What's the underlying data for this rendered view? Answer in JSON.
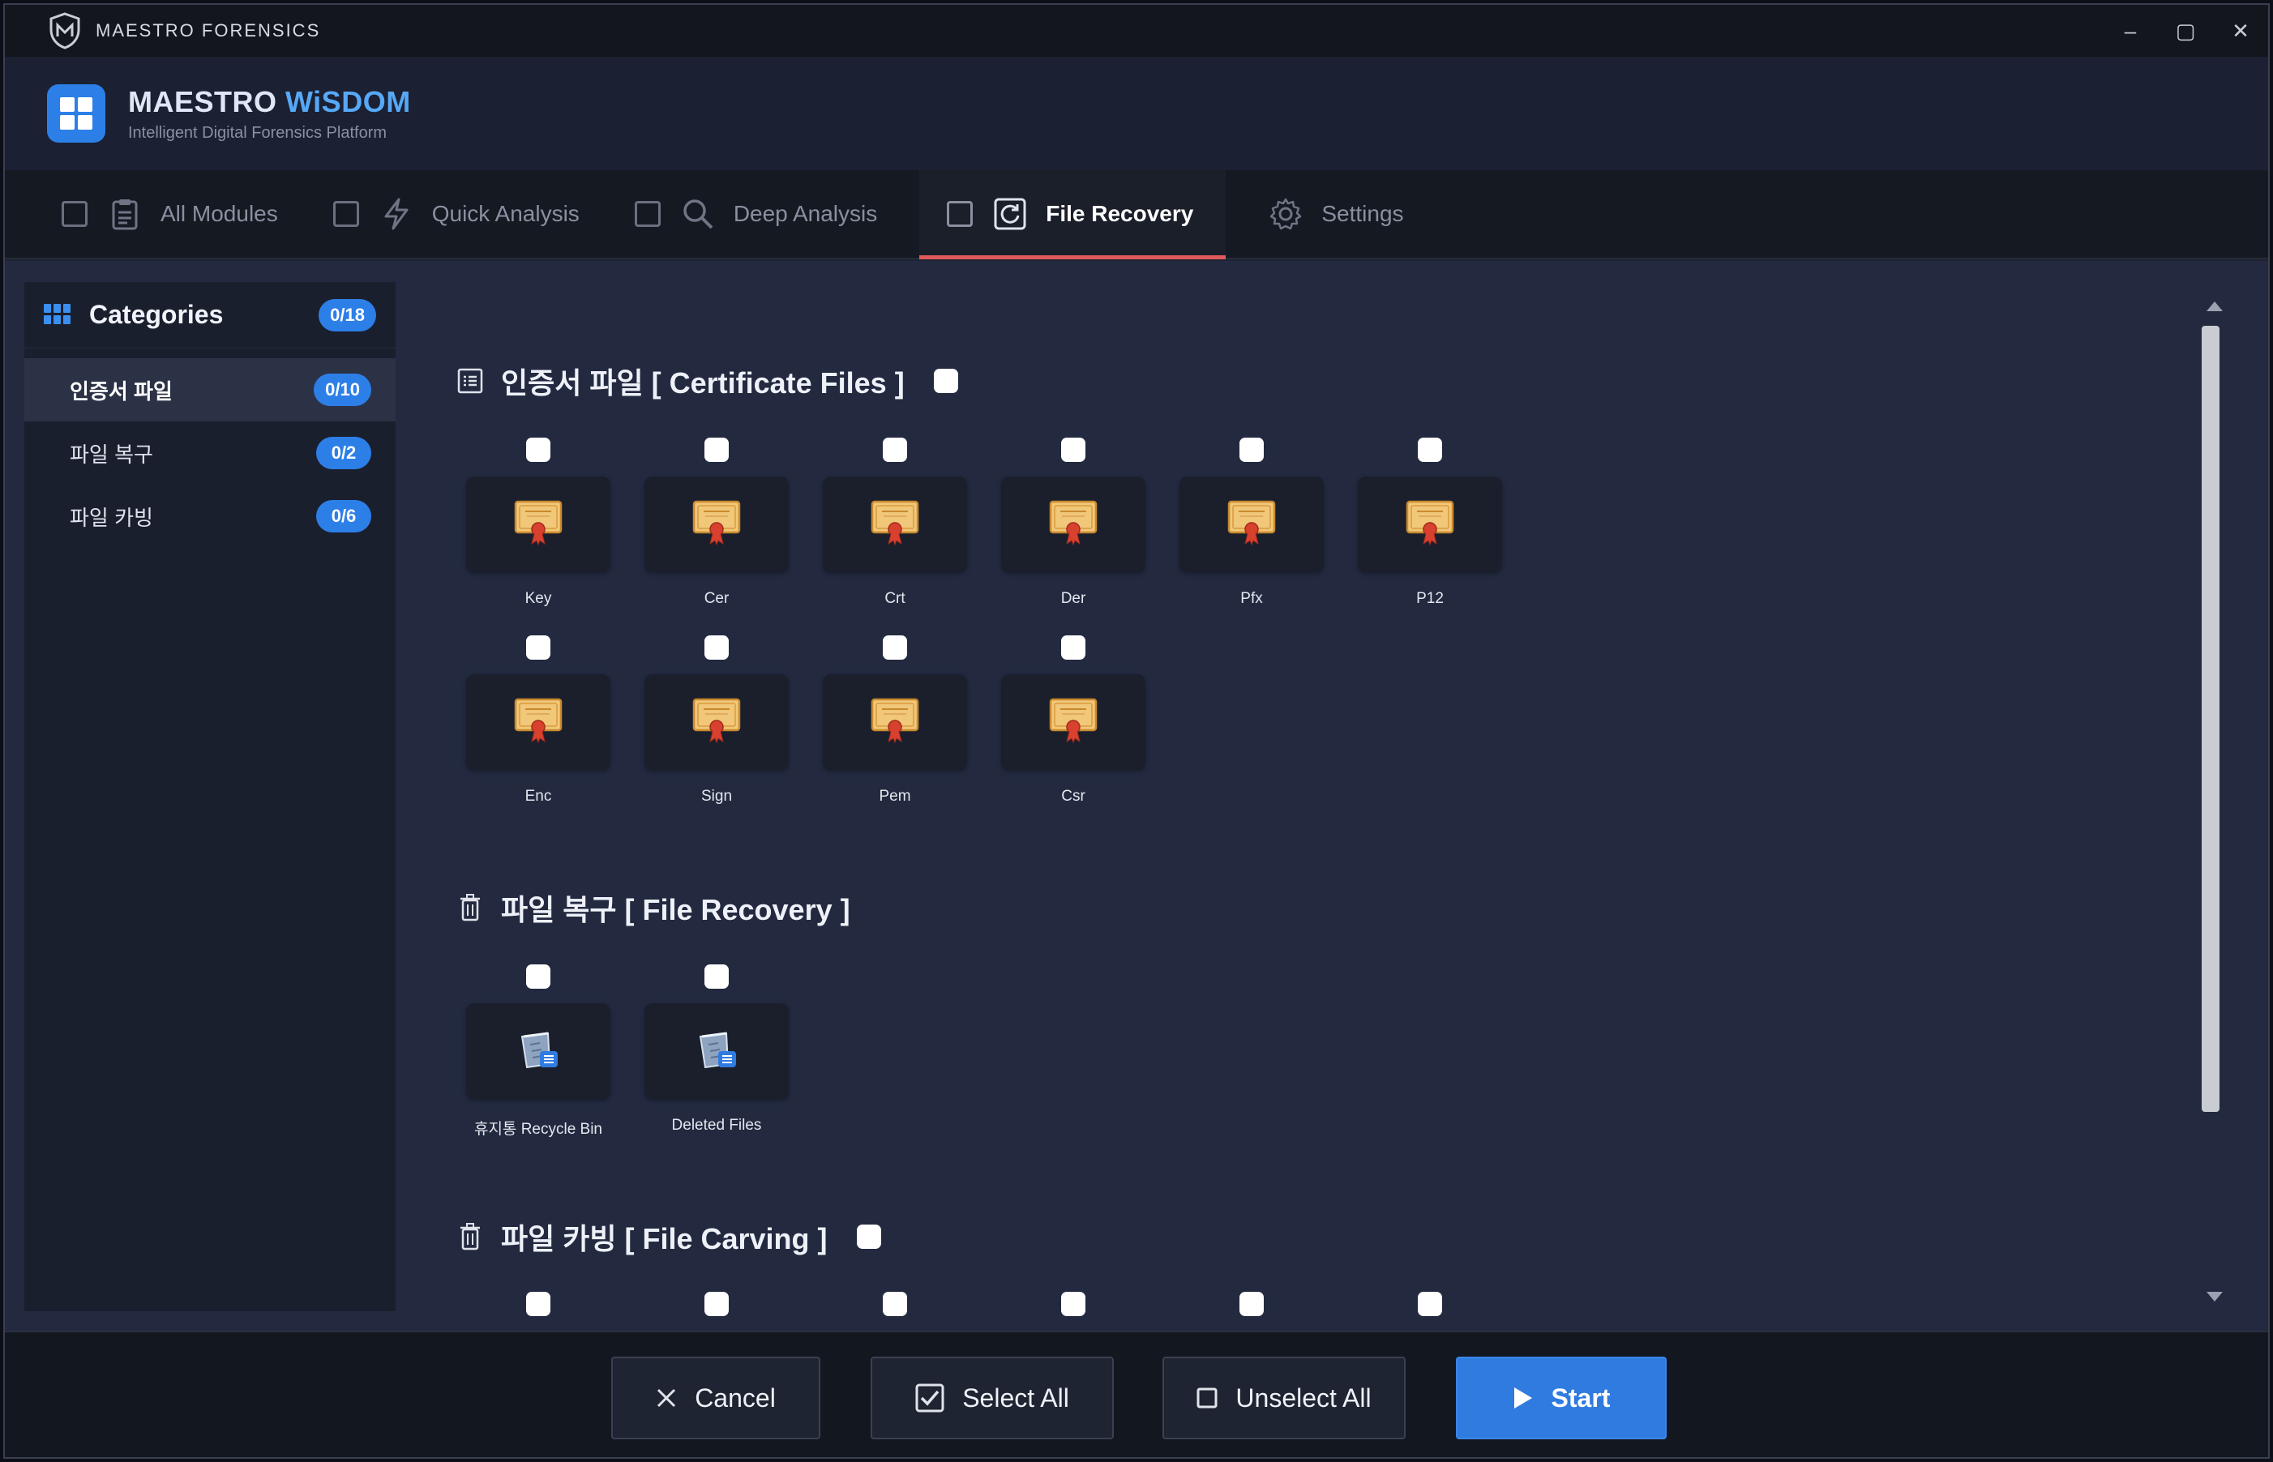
{
  "window": {
    "app_name": "MAESTRO FORENSICS",
    "controls": {
      "minimize": "–",
      "maximize": "▢",
      "close": "✕"
    }
  },
  "header": {
    "title_part1": "MAESTRO ",
    "title_part2": "WiSDOM",
    "subtitle": "Intelligent Digital Forensics Platform"
  },
  "tabs": [
    {
      "label": "All Modules",
      "icon": "clipboard-icon",
      "active": false
    },
    {
      "label": "Quick Analysis",
      "icon": "lightning-icon",
      "active": false
    },
    {
      "label": "Deep Analysis",
      "icon": "search-icon",
      "active": false
    },
    {
      "label": "File Recovery",
      "icon": "refresh-icon",
      "active": true
    },
    {
      "label": "Settings",
      "icon": "gear-icon",
      "active": false
    }
  ],
  "sidebar": {
    "title": "Categories",
    "count": "0/18",
    "items": [
      {
        "label": "인증서 파일",
        "count": "0/10",
        "active": true
      },
      {
        "label": "파일 복구",
        "count": "0/2",
        "active": false
      },
      {
        "label": "파일 카빙",
        "count": "0/6",
        "active": false
      }
    ]
  },
  "sections": {
    "certificate": {
      "title": "인증서 파일 [ Certificate Files ]",
      "items": [
        "Key",
        "Cer",
        "Crt",
        "Der",
        "Pfx",
        "P12",
        "Enc",
        "Sign",
        "Pem",
        "Csr"
      ]
    },
    "recovery": {
      "title": "파일 복구 [ File Recovery ]",
      "items": [
        "휴지통 Recycle Bin",
        "Deleted Files"
      ]
    },
    "carving": {
      "title": "파일 카빙 [ File Carving ]"
    }
  },
  "footer": {
    "cancel": "Cancel",
    "select_all": "Select All",
    "unselect_all": "Unselect All",
    "start": "Start"
  },
  "colors": {
    "accent": "#2f7be0",
    "active_tab_underline": "#e05a5a",
    "brand_highlight": "#57a8f5"
  }
}
